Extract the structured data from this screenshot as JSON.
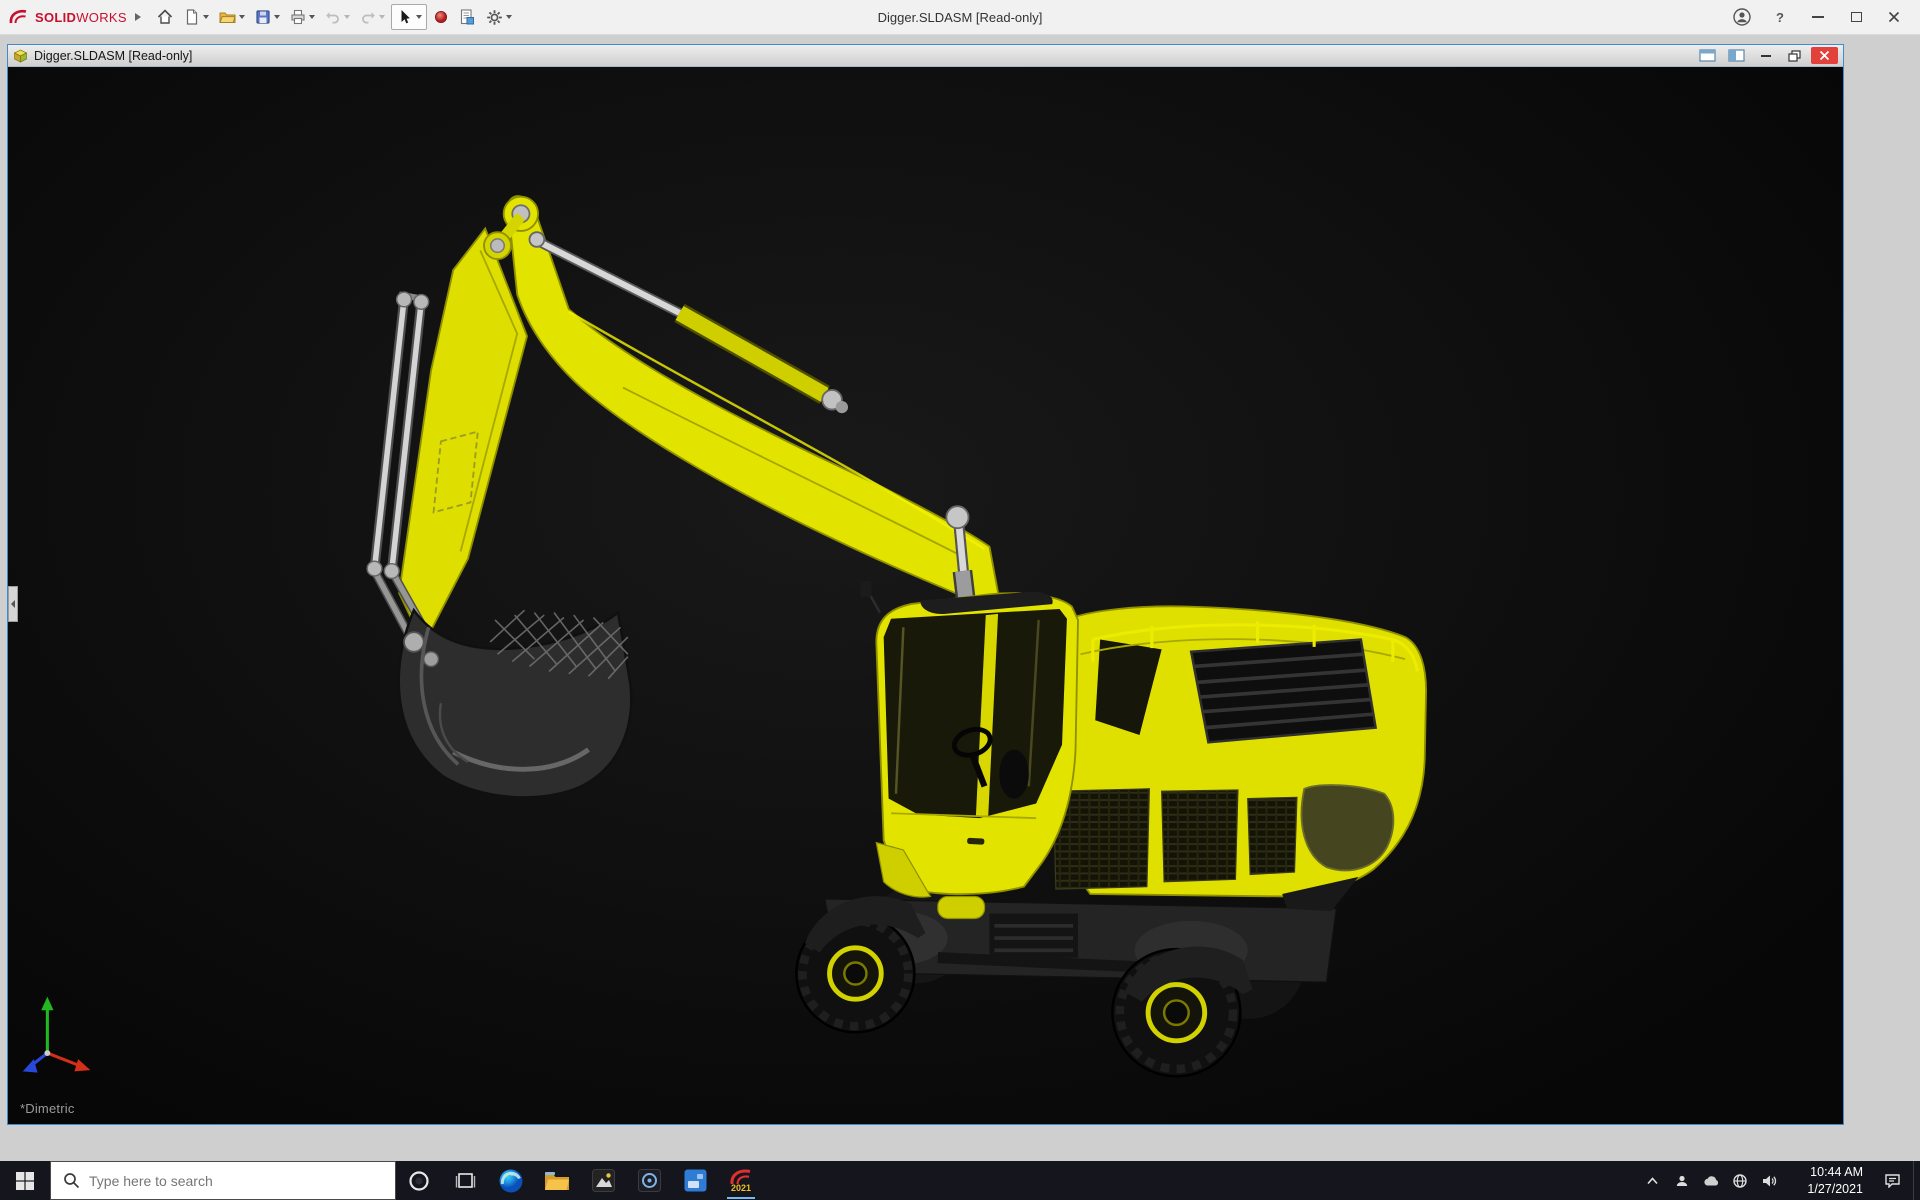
{
  "titlebar": {
    "title": "Digger.SLDASM [Read-only]",
    "brand_solid": "SOLID",
    "brand_works": "WORKS",
    "help_glyph": "?"
  },
  "doc": {
    "title": "Digger.SLDASM [Read-only]"
  },
  "viewport": {
    "view_label": "*Dimetric"
  },
  "taskbar": {
    "search_placeholder": "Type here to search",
    "time": "10:44 AM",
    "date": "1/27/2021",
    "sw_badge": "2021"
  },
  "icons": {
    "toolbar": [
      "home-icon",
      "new-document-icon",
      "open-icon",
      "save-icon",
      "print-icon",
      "undo-icon",
      "redo-icon",
      "select-icon",
      "appearance-icon",
      "document-settings-icon",
      "options-gear-icon"
    ],
    "titlebar_right": [
      "account-icon",
      "help-icon",
      "minimize-icon",
      "maximize-icon",
      "close-icon"
    ],
    "doc_controls": [
      "tile-window-icon",
      "split-window-icon",
      "minimize-icon",
      "restore-icon",
      "close-icon"
    ],
    "taskbar": [
      "start-icon",
      "search-icon",
      "cortana-icon",
      "task-view-icon",
      "edge-icon",
      "file-explorer-icon",
      "photos-icon",
      "media-app-icon",
      "blue-app-icon",
      "solidworks-icon"
    ],
    "tray": [
      "tray-expand-icon",
      "meet-now-icon",
      "onedrive-icon",
      "network-icon",
      "volume-icon",
      "notification-center-icon"
    ]
  },
  "colors": {
    "excavator_yellow": "#e3e300",
    "active_border_blue": "#3f8ccc",
    "taskbar_bg": "#15151d",
    "close_red": "#e2403a",
    "brand_red": "#c8102e"
  }
}
